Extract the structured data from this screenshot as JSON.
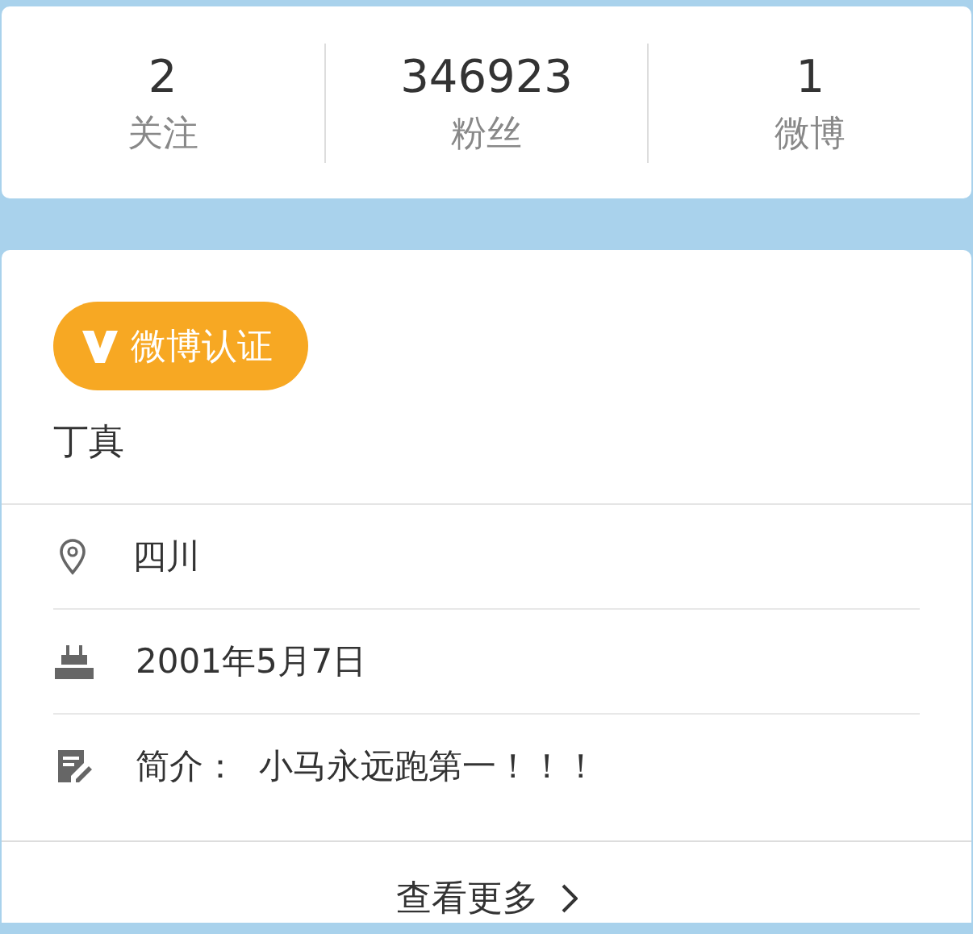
{
  "stats": [
    {
      "value": "2",
      "label": "关注"
    },
    {
      "value": "346923",
      "label": "粉丝"
    },
    {
      "value": "1",
      "label": "微博"
    }
  ],
  "profile": {
    "badge": "微博认证",
    "name": "丁真"
  },
  "details": [
    {
      "kind": "location",
      "text": "四川"
    },
    {
      "kind": "birthday",
      "text": "2001年5月7日"
    },
    {
      "kind": "intro",
      "text": "简介：  小马永远跑第一！！！"
    }
  ],
  "more_link": "查看更多"
}
